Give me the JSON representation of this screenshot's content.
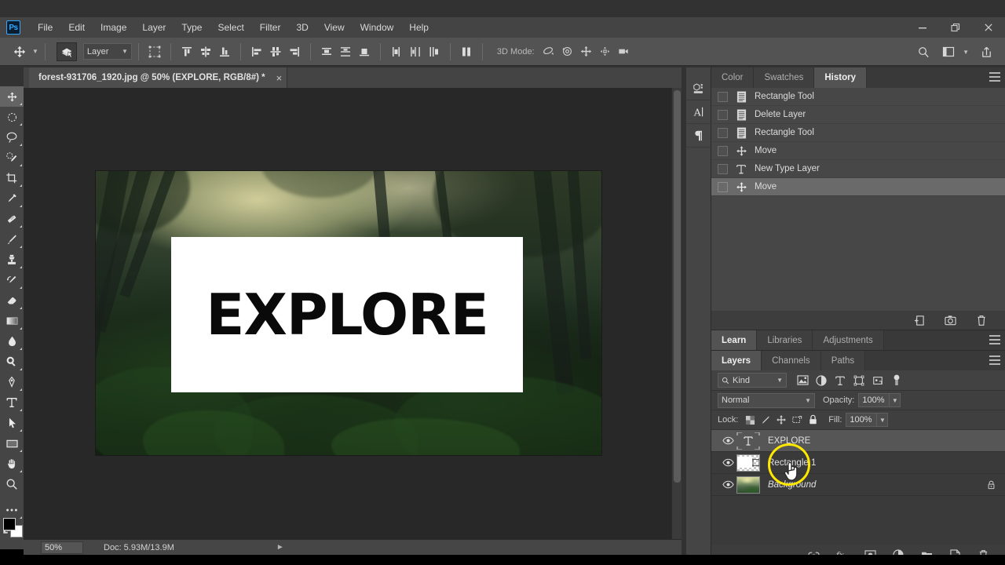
{
  "app": {
    "name": "Adobe Photoshop",
    "logo_text": "Ps"
  },
  "menubar": {
    "items": [
      "File",
      "Edit",
      "Image",
      "Layer",
      "Type",
      "Select",
      "Filter",
      "3D",
      "View",
      "Window",
      "Help"
    ]
  },
  "window_controls": {
    "minimize": "minimize-icon",
    "restore": "restore-icon",
    "close": "close-icon"
  },
  "options_bar": {
    "tool": "move-tool",
    "auto_select_label": "Layer",
    "three_d_mode_label": "3D Mode:",
    "align_icons": [
      "align-top-edges",
      "align-vertical-centers",
      "align-bottom-edges",
      "align-left-edges",
      "align-horizontal-centers",
      "align-right-edges"
    ],
    "distribute_icons": [
      "distribute-top-edges",
      "distribute-vertical-centers",
      "distribute-bottom-edges",
      "distribute-left-edges",
      "distribute-horizontal-centers",
      "distribute-right-edges"
    ],
    "extra_icons": [
      "distribute-spacing"
    ],
    "three_d_icons": [
      "3d-orbit",
      "3d-roll",
      "3d-pan",
      "3d-slide",
      "3d-camera"
    ],
    "right_icons": [
      "search-icon",
      "workspace-icon",
      "share-icon"
    ]
  },
  "toolbar": {
    "tools": [
      "move-tool",
      "marquee-tool",
      "lasso-tool",
      "quick-selection-tool",
      "crop-tool",
      "eyedropper-tool",
      "healing-brush-tool",
      "brush-tool",
      "clone-stamp-tool",
      "history-brush-tool",
      "eraser-tool",
      "gradient-tool",
      "blur-tool",
      "dodge-tool",
      "pen-tool",
      "type-tool",
      "path-selection-tool",
      "rectangle-tool",
      "hand-tool",
      "zoom-tool",
      "more-tools"
    ],
    "foreground_color": "#000000",
    "background_color": "#ffffff"
  },
  "document": {
    "tab_title": "forest-931706_1920.jpg @ 50% (EXPLORE, RGB/8#) *",
    "close_label": "×",
    "canvas_text": "EXPLORE",
    "zoom_value": "50%",
    "doc_info": "Doc: 5.93M/13.9M"
  },
  "dock_rail": {
    "buttons": [
      "3d-panel-icon",
      "character-panel-icon",
      "paragraph-panel-icon"
    ],
    "collapse": "«"
  },
  "history_panel": {
    "tabs": [
      {
        "label": "Color",
        "active": false
      },
      {
        "label": "Swatches",
        "active": false
      },
      {
        "label": "History",
        "active": true
      }
    ],
    "states": [
      {
        "label": "Rectangle Tool",
        "icon": "rectangle-tool-icon",
        "selected": false
      },
      {
        "label": "Delete Layer",
        "icon": "delete-layer-icon",
        "selected": false
      },
      {
        "label": "Rectangle Tool",
        "icon": "rectangle-tool-icon",
        "selected": false
      },
      {
        "label": "Move",
        "icon": "move-tool-icon",
        "selected": false
      },
      {
        "label": "New Type Layer",
        "icon": "type-tool-icon",
        "selected": false
      },
      {
        "label": "Move",
        "icon": "move-tool-icon",
        "selected": true
      }
    ],
    "footer_icons": [
      "new-document-from-state-icon",
      "create-snapshot-icon",
      "delete-state-icon"
    ]
  },
  "learn_panel": {
    "tabs": [
      {
        "label": "Learn",
        "active": true
      },
      {
        "label": "Libraries",
        "active": false
      },
      {
        "label": "Adjustments",
        "active": false
      }
    ]
  },
  "layers_panel": {
    "tabs": [
      {
        "label": "Layers",
        "active": true
      },
      {
        "label": "Channels",
        "active": false
      },
      {
        "label": "Paths",
        "active": false
      }
    ],
    "filter": {
      "kind_label": "Kind",
      "icons": [
        "filter-pixel-icon",
        "filter-adjustment-icon",
        "filter-type-icon",
        "filter-shape-icon",
        "filter-smart-object-icon",
        "filter-toggle-icon"
      ]
    },
    "blend_mode": "Normal",
    "opacity_label": "Opacity:",
    "opacity_value": "100%",
    "lock_label": "Lock:",
    "lock_icons": [
      "lock-transparent-pixels-icon",
      "lock-image-pixels-icon",
      "lock-position-icon",
      "lock-artboard-nesting-icon",
      "lock-all-icon"
    ],
    "fill_label": "Fill:",
    "fill_value": "100%",
    "layers": [
      {
        "name": "EXPLORE",
        "type": "type",
        "visible": true,
        "selected": true,
        "locked": false,
        "italic": false
      },
      {
        "name": "Rectangle 1",
        "type": "shape",
        "visible": true,
        "selected": false,
        "locked": false,
        "italic": false
      },
      {
        "name": "Background",
        "type": "image",
        "visible": true,
        "selected": false,
        "locked": true,
        "italic": true
      }
    ],
    "footer_icons": [
      "link-layers-icon",
      "layer-style-icon",
      "layer-mask-icon",
      "new-fill-adjustment-icon",
      "new-group-icon",
      "new-layer-icon",
      "delete-layer-icon"
    ]
  },
  "annotation": {
    "highlight_color": "#ffe800",
    "cursor": "pointing-hand-cursor"
  }
}
